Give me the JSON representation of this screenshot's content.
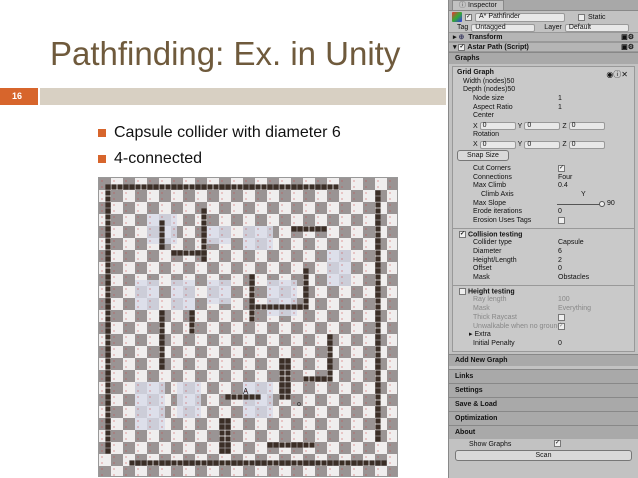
{
  "slide": {
    "title": "Pathfinding: Ex. in Unity",
    "number": "16",
    "bullets": [
      "Capsule collider with diameter 6",
      "4-connected"
    ]
  },
  "colors": {
    "accent": "#d7652c",
    "obstacle": "#3b2e26",
    "free": "#f0eeee",
    "blocked": "#8b8484"
  },
  "grid": {
    "cols": 50,
    "rows": 50,
    "obstacles": [
      [
        1,
        1,
        40,
        2
      ],
      [
        1,
        2,
        2,
        46
      ],
      [
        5,
        47,
        48,
        48
      ],
      [
        46,
        2,
        47,
        44
      ],
      [
        17,
        5,
        18,
        14
      ],
      [
        12,
        12,
        18,
        13
      ],
      [
        32,
        8,
        38,
        9
      ],
      [
        25,
        16,
        26,
        24
      ],
      [
        26,
        21,
        35,
        22
      ],
      [
        34,
        15,
        35,
        21
      ],
      [
        30,
        30,
        32,
        37
      ],
      [
        38,
        26,
        39,
        34
      ],
      [
        34,
        33,
        38,
        34
      ],
      [
        21,
        36,
        27,
        37
      ],
      [
        10,
        7,
        11,
        12
      ],
      [
        10,
        22,
        11,
        32
      ],
      [
        20,
        40,
        22,
        46
      ],
      [
        15,
        22,
        16,
        26
      ],
      [
        28,
        44,
        36,
        45
      ]
    ],
    "soft": [
      [
        8,
        6,
        13,
        11
      ],
      [
        18,
        8,
        22,
        11
      ],
      [
        24,
        8,
        29,
        12
      ],
      [
        38,
        12,
        42,
        18
      ],
      [
        6,
        17,
        10,
        22
      ],
      [
        12,
        17,
        16,
        22
      ],
      [
        18,
        17,
        22,
        21
      ],
      [
        28,
        17,
        33,
        23
      ],
      [
        6,
        34,
        11,
        42
      ],
      [
        13,
        34,
        17,
        40
      ],
      [
        24,
        34,
        29,
        40
      ]
    ],
    "agent": {
      "label": "A",
      "col": 24,
      "row": 36
    },
    "target": {
      "label": "o",
      "col": 33,
      "row": 38
    }
  },
  "inspector": {
    "tab": "Inspector",
    "object_name": "A* Pathfinder",
    "static_label": "Static",
    "tag_label": "Tag",
    "tag_value": "Untagged",
    "layer_label": "Layer",
    "layer_value": "Default",
    "components": {
      "transform": "Transform",
      "astar": "Astar Path (Script)"
    },
    "graphs_section": "Graphs",
    "grid_graph": "Grid Graph",
    "width": "Width (nodes)50",
    "depth": "Depth (nodes)50",
    "node_size": {
      "label": "Node size",
      "value": "1"
    },
    "aspect": {
      "label": "Aspect Ratio",
      "value": "1"
    },
    "center": "Center",
    "center_vals": {
      "x": "0",
      "y": "0",
      "z": "0"
    },
    "rotation": "Rotation",
    "rotation_vals": {
      "x": "0",
      "y": "0",
      "z": "0"
    },
    "snap": "Snap Size",
    "cut_corners": "Cut Corners",
    "connections": {
      "label": "Connections",
      "value": "Four"
    },
    "max_climb": {
      "label": "Max Climb",
      "value": "0.4"
    },
    "climb_axis": {
      "label": "Climb Axis",
      "value": "Y"
    },
    "max_slope": {
      "label": "Max Slope",
      "value": "90",
      "fraction": 0.98
    },
    "erode": {
      "label": "Erode iterations",
      "value": "0"
    },
    "erosion": "Erosion Uses Tags",
    "collision": "Collision testing",
    "collider_type": {
      "label": "Collider type",
      "value": "Capsule"
    },
    "diameter": {
      "label": "Diameter",
      "value": "6"
    },
    "height_length": {
      "label": "Height/Length",
      "value": "2"
    },
    "offset": {
      "label": "Offset",
      "value": "0"
    },
    "mask": {
      "label": "Mask",
      "value": "Obstacles"
    },
    "height_testing": "Height testing",
    "ray_length": {
      "label": "Ray length",
      "value": "100"
    },
    "mask2": {
      "label": "Mask",
      "value": "Everything"
    },
    "thick_raycast": "Thick Raycast",
    "unwalkable": "Unwalkable when no ground",
    "extra": "Extra",
    "initial_penalty": {
      "label": "Initial Penalty",
      "value": "0"
    },
    "add_graph": "Add New Graph",
    "sections": [
      "Links",
      "Settings",
      "Save & Load",
      "Optimization",
      "About"
    ],
    "show_graphs": "Show Graphs",
    "scan": "Scan"
  }
}
